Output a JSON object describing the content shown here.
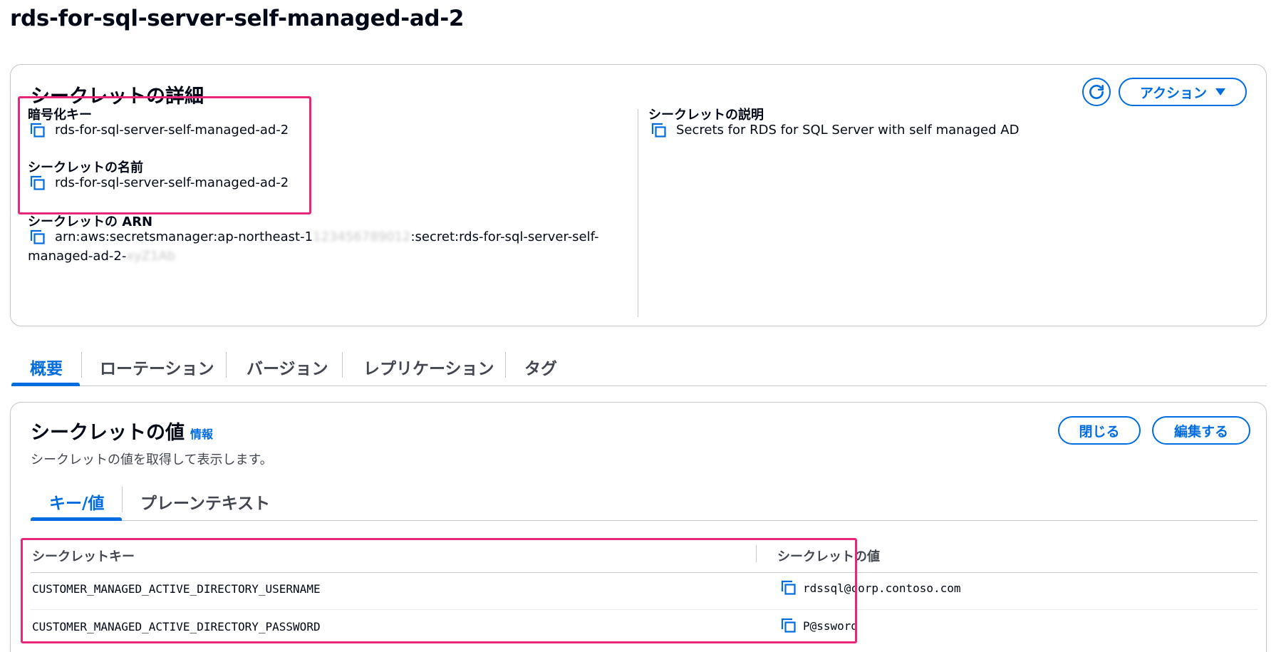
{
  "page": {
    "title": "rds-for-sql-server-self-managed-ad-2"
  },
  "details": {
    "title": "シークレットの詳細",
    "actions_label": "アクション",
    "fields": {
      "encryption_key": {
        "label": "暗号化キー",
        "value": "rds-for-sql-server-self-managed-ad-2"
      },
      "secret_name": {
        "label": "シークレットの名前",
        "value": "rds-for-sql-server-self-managed-ad-2"
      },
      "secret_arn": {
        "label": "シークレットの ARN",
        "prefix": "arn:aws:secretsmanager:ap-northeast-1",
        "redacted_account": "123456789012",
        "middle": ":secret:rds-for-sql-server-self-",
        "line2": "managed-ad-2-",
        "redacted_suffix": "xyZ1Ab"
      },
      "description": {
        "label": "シークレットの説明",
        "value": "Secrets for RDS for SQL Server with self managed AD"
      }
    }
  },
  "tabs": [
    {
      "label": "概要"
    },
    {
      "label": "ローテーション"
    },
    {
      "label": "バージョン"
    },
    {
      "label": "レプリケーション"
    },
    {
      "label": "タグ"
    }
  ],
  "value_card": {
    "title": "シークレットの値",
    "info_link": "情報",
    "description": "シークレットの値を取得して表示します。",
    "close_label": "閉じる",
    "edit_label": "編集する",
    "subtabs": [
      {
        "label": "キー/値"
      },
      {
        "label": "プレーンテキスト"
      }
    ],
    "table": {
      "headers": [
        "シークレットキー",
        "シークレットの値"
      ],
      "rows": [
        {
          "key": "CUSTOMER_MANAGED_ACTIVE_DIRECTORY_USERNAME",
          "value": "rdssql@corp.contoso.com"
        },
        {
          "key": "CUSTOMER_MANAGED_ACTIVE_DIRECTORY_PASSWORD",
          "value": "P@ssword"
        }
      ]
    }
  },
  "colors": {
    "accent": "#006ce0",
    "highlight": "#e8267a",
    "text": "#000716",
    "border": "#c6c6cd"
  },
  "icons": {
    "copy": "copy-icon",
    "refresh": "refresh-icon",
    "caret": "caret-down-icon"
  }
}
